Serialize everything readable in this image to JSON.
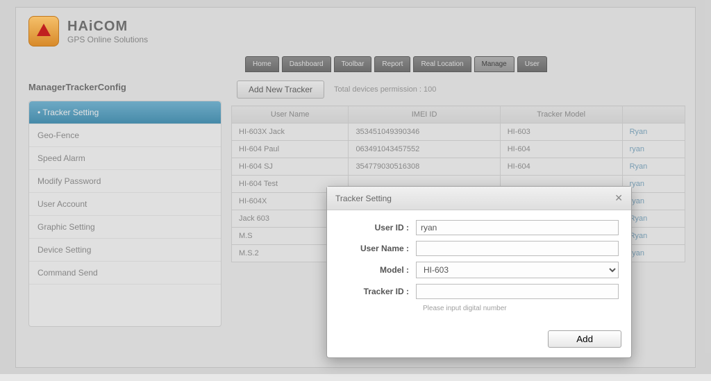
{
  "brand": {
    "name": "HAiCOM",
    "sub": "GPS Online Solutions"
  },
  "tabs": [
    {
      "label": "Home"
    },
    {
      "label": "Dashboard"
    },
    {
      "label": "Toolbar"
    },
    {
      "label": "Report"
    },
    {
      "label": "Real Location"
    },
    {
      "label": "Manage"
    },
    {
      "label": "User"
    }
  ],
  "active_tab": 5,
  "breadcrumb": "ManagerTrackerConfig",
  "sidebar": {
    "items": [
      "Tracker Setting",
      "Geo-Fence",
      "Speed Alarm",
      "Modify Password",
      "User Account",
      "Graphic Setting",
      "Device Setting",
      "Command Send"
    ],
    "active": 0,
    "active_prefix": "• "
  },
  "add_button": "Add New Tracker",
  "permission_label": "Total devices permission : 100",
  "table": {
    "cols": [
      "User Name",
      "IMEI ID",
      "Tracker Model",
      ""
    ],
    "rows": [
      {
        "name": "HI-603X Jack",
        "imei": "353451049390346",
        "model": "HI-603",
        "owner": "Ryan"
      },
      {
        "name": "HI-604 Paul",
        "imei": "063491043457552",
        "model": "HI-604",
        "owner": "ryan"
      },
      {
        "name": "HI-604 SJ",
        "imei": "354779030516308",
        "model": "HI-604",
        "owner": "Ryan"
      },
      {
        "name": "HI-604 Test",
        "imei": "",
        "model": "",
        "owner": "ryan"
      },
      {
        "name": "HI-604X",
        "imei": "",
        "model": "",
        "owner": "ryan"
      },
      {
        "name": "Jack 603",
        "imei": "",
        "model": "",
        "owner": "Ryan"
      },
      {
        "name": "M.S",
        "imei": "",
        "model": "",
        "owner": "Ryan"
      },
      {
        "name": "M.S.2",
        "imei": "",
        "model": "",
        "owner": "ryan"
      }
    ]
  },
  "dialog": {
    "title": "Tracker Setting",
    "labels": {
      "user_id": "User ID :",
      "user_name": "User Name :",
      "model": "Model :",
      "tracker_id": "Tracker ID :"
    },
    "values": {
      "user_id": "ryan",
      "user_name": "",
      "model": "HI-603",
      "tracker_id": ""
    },
    "note": "Please input digital number",
    "add_label": "Add"
  }
}
